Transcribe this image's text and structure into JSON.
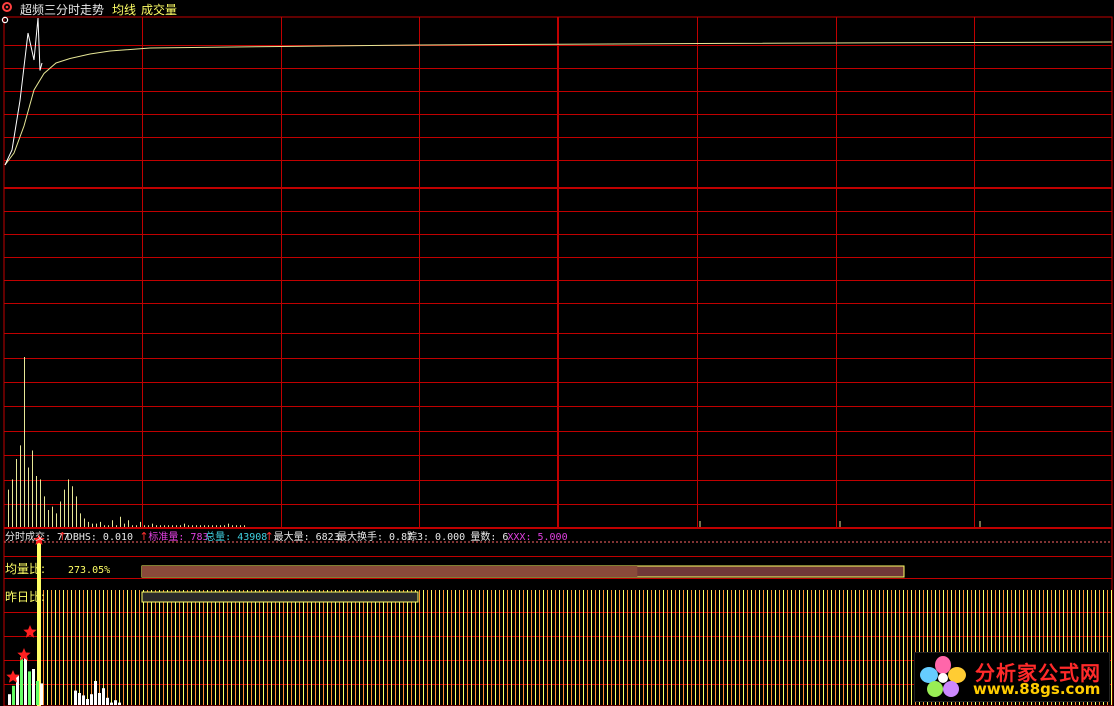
{
  "header": {
    "title": "超频三分时走势",
    "avg_label": "均线",
    "vol_label": "成交量"
  },
  "indicator": {
    "items": [
      {
        "text": "分时成交: 77",
        "color": "#e8e8e8",
        "arrow": true
      },
      {
        "text": "DBHS: 0.010",
        "color": "#e8e8e8",
        "arrow": true
      },
      {
        "text": "标准量: 783",
        "color": "#e040e0",
        "arrow": false
      },
      {
        "text": "总量: 43908",
        "color": "#40d0e0",
        "arrow": true
      },
      {
        "text": "最大量: 6823",
        "color": "#e8e8e8",
        "arrow": false
      },
      {
        "text": "最大换手: 0.87",
        "color": "#e8e8e8",
        "arrow": false
      },
      {
        "text": "踪3: 0.000",
        "color": "#e8e8e8",
        "arrow": false
      },
      {
        "text": "量数: 6",
        "color": "#e8e8e8",
        "arrow": false
      },
      {
        "text": "XXX: 5.000",
        "color": "#e040e0",
        "arrow": false
      }
    ],
    "arrow_symbol": "↑"
  },
  "ratios": {
    "avg_vol_label": "均量比:",
    "avg_vol_value": "273.05%",
    "avg_vol_fill": 0.65,
    "prev_day_label": "昨日比:",
    "prev_day_fill": 0.24
  },
  "watermark": {
    "name": "分析家公式网",
    "url": "www.88gs.com"
  },
  "colors": {
    "grid": "#c00000",
    "price": "#ffffff",
    "avg": "#e6e696",
    "volume": "#e6e696",
    "bar_orange": "#ff9933",
    "bar_yellow": "#ffff66",
    "bar_green": "#66ff66",
    "bar_white": "#ffffff",
    "star": "#ff2020"
  },
  "icons": [
    "gear-icon",
    "star-icon",
    "flower-logo-icon"
  ],
  "chart_data": {
    "type": "line",
    "price_series": [
      0.02,
      0.12,
      0.45,
      0.9,
      0.72,
      1.0,
      0.65,
      0.7
    ],
    "avg_series": [
      0.02,
      0.1,
      0.28,
      0.52,
      0.63,
      0.7,
      0.73,
      0.76,
      0.78,
      0.8,
      0.81,
      0.82,
      0.83,
      0.84
    ],
    "volume_series": [
      22,
      28,
      40,
      48,
      100,
      35,
      45,
      30,
      28,
      18,
      10,
      12,
      8,
      15,
      22,
      28,
      24,
      18,
      8,
      5,
      3,
      2,
      2,
      3,
      1,
      1,
      4,
      1,
      6,
      2,
      4,
      1,
      1,
      3,
      1,
      1,
      2,
      1,
      1,
      1,
      1,
      1,
      1,
      1,
      2,
      1,
      1,
      1,
      1,
      1,
      1,
      1,
      1,
      1,
      1,
      2,
      1,
      1,
      1,
      1
    ],
    "lower_bars": [
      {
        "v": 0.09,
        "c": "white"
      },
      {
        "v": 0.16,
        "c": "green"
      },
      {
        "v": 0.25,
        "c": "white"
      },
      {
        "v": 0.4,
        "c": "green"
      },
      {
        "v": 0.42,
        "c": "white"
      },
      {
        "v": 0.28,
        "c": "green"
      },
      {
        "v": 0.3,
        "c": "white"
      },
      {
        "v": 0.2,
        "c": "green"
      },
      {
        "v": 0.18,
        "c": "white"
      },
      {
        "v": 0.12,
        "c": "white"
      },
      {
        "v": 0.1,
        "c": "white"
      },
      {
        "v": 0.08,
        "c": "white"
      },
      {
        "v": 0.05,
        "c": "white"
      },
      {
        "v": 0.09,
        "c": "white"
      },
      {
        "v": 0.2,
        "c": "white"
      },
      {
        "v": 0.1,
        "c": "white"
      },
      {
        "v": 0.14,
        "c": "white"
      },
      {
        "v": 0.06,
        "c": "white"
      },
      {
        "v": 0.02,
        "c": "white"
      },
      {
        "v": 0.04,
        "c": "white"
      },
      {
        "v": 0.02,
        "c": "white"
      }
    ],
    "big_bar": 0.98
  }
}
